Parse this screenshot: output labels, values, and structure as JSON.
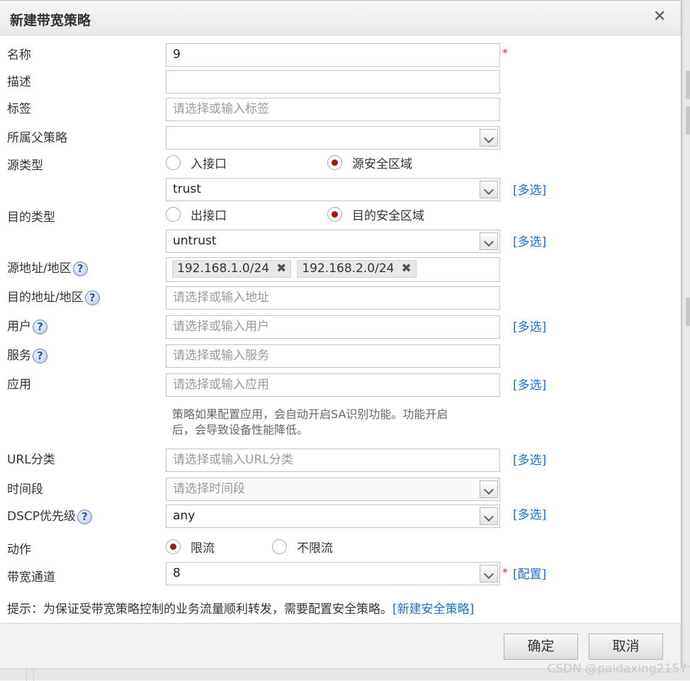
{
  "dialog": {
    "title": "新建带宽策略",
    "close_glyph": "✕"
  },
  "form": {
    "name": {
      "label": "名称",
      "value": "9",
      "required": "*"
    },
    "desc": {
      "label": "描述",
      "value": ""
    },
    "tags": {
      "label": "标签",
      "placeholder": "请选择或输入标签"
    },
    "parent": {
      "label": "所属父策略",
      "value": ""
    },
    "src_type": {
      "label": "源类型",
      "options": [
        "入接口",
        "源安全区域"
      ],
      "selected": "源安全区域",
      "value": "trust",
      "multi_link": "[多选]"
    },
    "dst_type": {
      "label": "目的类型",
      "options": [
        "出接口",
        "目的安全区域"
      ],
      "selected": "目的安全区域",
      "value": "untrust",
      "multi_link": "[多选]"
    },
    "src_addr": {
      "label": "源地址/地区",
      "tags": [
        "192.168.1.0/24",
        "192.168.2.0/24"
      ],
      "remove_glyph": "✖"
    },
    "dst_addr": {
      "label": "目的地址/地区",
      "placeholder": "请选择或输入地址"
    },
    "user": {
      "label": "用户",
      "placeholder": "请选择或输入用户",
      "multi_link": "[多选]"
    },
    "service": {
      "label": "服务",
      "placeholder": "请选择或输入服务"
    },
    "app": {
      "label": "应用",
      "placeholder": "请选择或输入应用",
      "multi_link": "[多选]",
      "note_line1": "策略如果配置应用，会自动开启SA识别功能。功能开启",
      "note_line2": "后，会导致设备性能降低。"
    },
    "url": {
      "label": "URL分类",
      "placeholder": "请选择或输入URL分类",
      "multi_link": "[多选]"
    },
    "schedule": {
      "label": "时间段",
      "placeholder": "请选择时间段"
    },
    "dscp": {
      "label": "DSCP优先级",
      "value": "any",
      "multi_link": "[多选]"
    },
    "action": {
      "label": "动作",
      "options": [
        "限流",
        "不限流"
      ],
      "selected": "限流"
    },
    "channel": {
      "label": "带宽通道",
      "value": "8",
      "required": "*",
      "config_link": "[配置]"
    },
    "help_glyph": "?"
  },
  "hint": {
    "text": "提示：为保证受带宽策略控制的业务流量顺利转发，需要配置安全策略。",
    "link": "[新建安全策略]"
  },
  "buttons": {
    "ok": "确定",
    "cancel": "取消"
  },
  "watermark": "CSDN @paidaxing2157"
}
